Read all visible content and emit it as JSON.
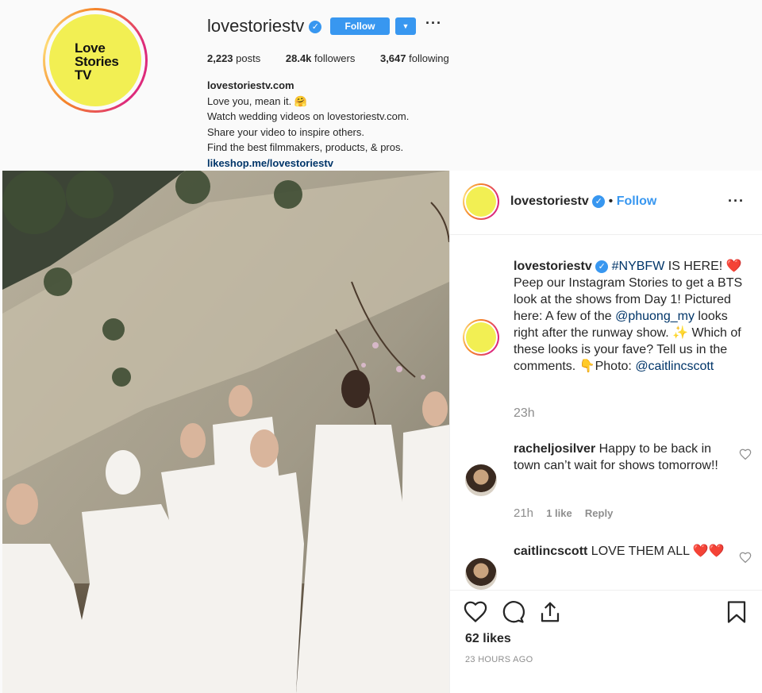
{
  "profile": {
    "logo_lines": [
      "Love",
      "Stories",
      "TV"
    ],
    "username": "lovestoriestv",
    "follow_label": "Follow",
    "more_glyph": "···",
    "stats": [
      {
        "value": "2,223",
        "label": "posts"
      },
      {
        "value": "28.4k",
        "label": "followers"
      },
      {
        "value": "3,647",
        "label": "following"
      }
    ],
    "bio_name": "lovestoriestv.com",
    "bio_lines": [
      "Love you, mean it. 🤗",
      "Watch wedding videos on lovestoriestv.com.",
      "Share your video to inspire others.",
      "Find the best filmmakers, products, & pros."
    ],
    "bio_link": "likeshop.me/lovestoriestv"
  },
  "post": {
    "header_username": "lovestoriestv",
    "header_follow": "Follow",
    "header_dot": "•",
    "caption": {
      "username": "lovestoriestv",
      "hashtag": "#NYBFW",
      "text1": " IS HERE! ❤️ Peep our Instagram Stories to get a BTS look at the shows from Day 1! Pictured here: A few of the ",
      "mention1": "@phuong_my",
      "text2": " looks right after the runway show. ✨ Which of these looks is your fave? Tell us in the comments. 👇Photo: ",
      "mention2": "@caitlincscott",
      "time": "23h"
    },
    "comments": [
      {
        "username": "racheljosilver",
        "text": " Happy to be back in town can’t wait for shows tomorrow!!",
        "time": "21h",
        "likes": "1 like",
        "reply": "Reply"
      },
      {
        "username": "caitlincscott",
        "text": " LOVE THEM ALL ❤️❤️"
      }
    ],
    "likes": "62 likes",
    "timestamp": "23 HOURS AGO"
  },
  "colors": {
    "accent": "#3897f0",
    "logo_yellow": "#f2ef53",
    "link": "#003569"
  }
}
